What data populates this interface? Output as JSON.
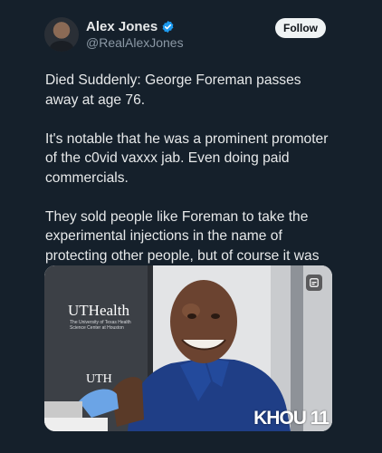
{
  "post": {
    "author_name": "Alex Jones",
    "author_handle": "@RealAlexJones",
    "follow_label": "Follow",
    "paragraphs": [
      "Died Suddenly: George Foreman passes away at age 76.",
      "It's notable that he was a prominent promoter of the c0vid vaxxx jab. Even doing paid commercials.",
      "They sold people like Foreman to take the experimental injections in the name of protecting other people, but of course it was all a lie."
    ]
  },
  "media": {
    "logo_text": "UTHealth",
    "logo_subtext": "The University of Texas Health Science Center at Houston",
    "logo_bottom": "UTH",
    "watermark": "KHOU 11",
    "icon": "caption-icon"
  },
  "colors": {
    "background": "#15202b",
    "text": "#e7e9ea",
    "muted": "#8b98a5",
    "verified": "#1d9bf0",
    "follow_bg": "#eff3f4"
  }
}
